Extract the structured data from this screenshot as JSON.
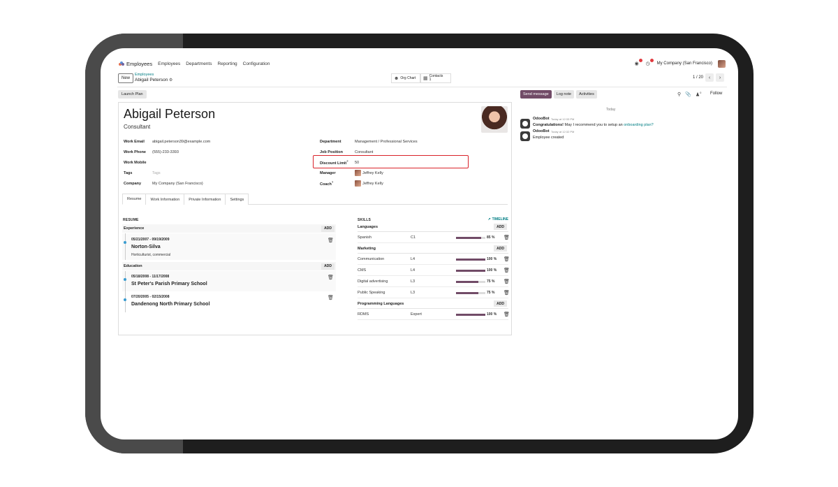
{
  "navbar": {
    "app_name": "Employees",
    "menu": [
      "Employees",
      "Departments",
      "Reporting",
      "Configuration"
    ],
    "company": "My Company (San Francisco)",
    "messages_badge": "1",
    "activities_badge": "1"
  },
  "control_panel": {
    "new_label": "New",
    "breadcrumb_parent": "Employees",
    "breadcrumb_current": "Abigail Peterson",
    "org_chart_label": "Org Chart",
    "contacts_label": "Contacts",
    "contacts_count": "1",
    "pager_value": "1 / 20"
  },
  "actions": {
    "launch_plan": "Launch Plan"
  },
  "employee": {
    "name": "Abigail Peterson",
    "job_title": "Consultant",
    "fields_left": [
      {
        "label": "Work Email",
        "value": "abigail.peterson39@example.com"
      },
      {
        "label": "Work Phone",
        "value": "(555)-233-3393"
      },
      {
        "label": "Work Mobile",
        "value": ""
      },
      {
        "label": "Tags",
        "value": "Tags"
      },
      {
        "label": "Company",
        "value": "My Company (San Francisco)"
      }
    ],
    "fields_right": [
      {
        "label": "Department",
        "value": "Management / Professional Services"
      },
      {
        "label": "Job Position",
        "value": "Consultant"
      },
      {
        "label": "Discount Limit",
        "value": "50"
      },
      {
        "label": "Manager",
        "value": "Jeffrey Kelly"
      },
      {
        "label": "Coach",
        "value": "Jeffrey Kelly"
      }
    ]
  },
  "tabs": [
    "Resume",
    "Work Information",
    "Private Information",
    "Settings"
  ],
  "resume": {
    "title": "RESUME",
    "add_label": "ADD",
    "experience_label": "Experience",
    "education_label": "Education",
    "experience": [
      {
        "date": "05/21/2007 - 09/19/2009",
        "name": "Norton-Silva",
        "desc": "Horticulturist, commercial"
      }
    ],
    "education": [
      {
        "date": "05/18/2008 - 11/17/2008",
        "name": "St Peter's Parish Primary School",
        "desc": ""
      },
      {
        "date": "07/20/2005 - 02/15/2008",
        "name": "Dandenong North Primary School",
        "desc": ""
      }
    ]
  },
  "skills": {
    "title": "SKILLS",
    "timeline_label": "TIMELINE",
    "add_label": "ADD",
    "groups": [
      {
        "name": "Languages",
        "rows": [
          {
            "skill": "Spanish",
            "level": "C1",
            "progress": 85,
            "pct": "85 %"
          }
        ]
      },
      {
        "name": "Marketing",
        "rows": [
          {
            "skill": "Communication",
            "level": "L4",
            "progress": 100,
            "pct": "100 %"
          },
          {
            "skill": "CMS",
            "level": "L4",
            "progress": 100,
            "pct": "100 %"
          },
          {
            "skill": "Digital advertising",
            "level": "L3",
            "progress": 75,
            "pct": "75 %"
          },
          {
            "skill": "Public Speaking",
            "level": "L3",
            "progress": 75,
            "pct": "75 %"
          }
        ]
      },
      {
        "name": "Programming Languages",
        "rows": [
          {
            "skill": "RDMS",
            "level": "Expert",
            "progress": 100,
            "pct": "100 %"
          }
        ]
      }
    ]
  },
  "chatter": {
    "send_message": "Send message",
    "log_note": "Log note",
    "activities": "Activities",
    "followers_count": "0",
    "follow": "Follow",
    "date_separator": "Today",
    "messages": [
      {
        "author": "OdooBot",
        "time": "Today at 12:33 PM",
        "bold": "Congratulations!",
        "text": " May I recommend you to setup an ",
        "link": "onboarding plan?"
      },
      {
        "author": "OdooBot",
        "time": "Today at 12:32 PM",
        "bold": "",
        "text": "Employee created",
        "link": ""
      }
    ]
  },
  "colors": {
    "primary": "#714b67",
    "link": "#017e84",
    "highlight_border": "#d9222a"
  }
}
